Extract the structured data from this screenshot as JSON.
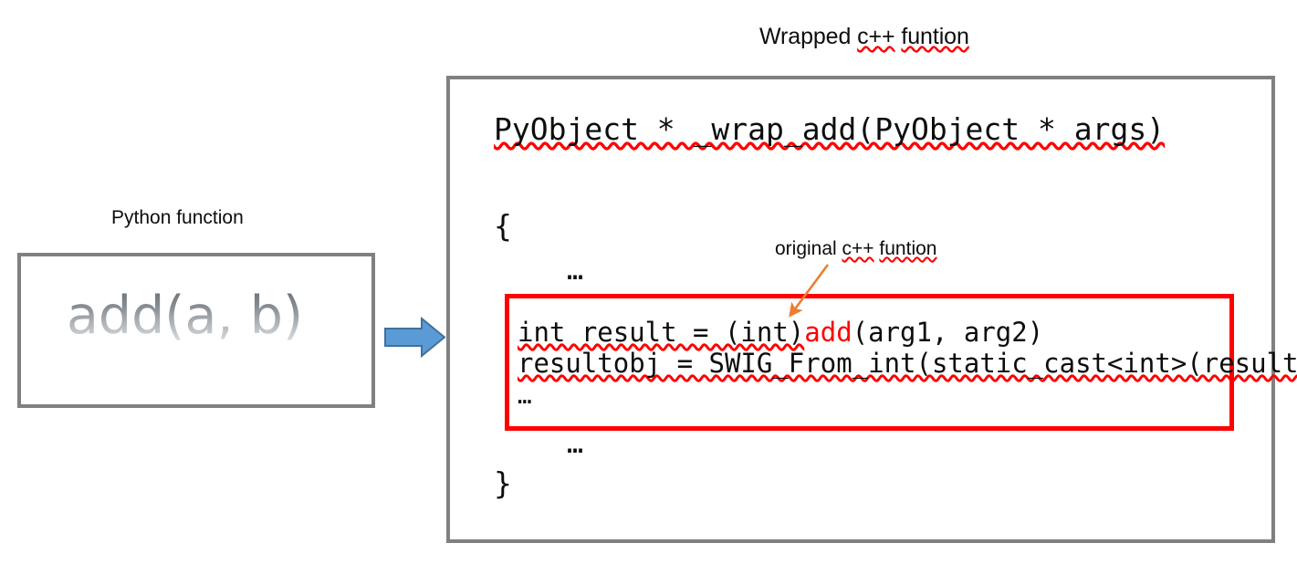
{
  "diagram": {
    "title_wrapped": {
      "prefix": "Wrapped ",
      "misspelled_1": "c++",
      "gap": " ",
      "misspelled_2": "funtion"
    },
    "python_side": {
      "label": "Python function",
      "code": "add(a, b)"
    },
    "arrow_flow": {
      "name": "right-arrow",
      "color": "#5b9bd5"
    },
    "wrapped_side": {
      "signature": "PyObject * _wrap_add(PyObject * args)",
      "brace_open": "{",
      "ellipsis_1": "…",
      "ellipsis_2": "…",
      "brace_close": "}"
    },
    "highlight": {
      "line1_before": "int result = (int)",
      "line1_call": "add",
      "line1_after": "(arg1, arg2)",
      "line2": "resultobj = SWIG_From_int(static_cast<int>(result))",
      "ellipsis": "…",
      "border_color": "#ff0000"
    },
    "annotation": {
      "prefix": "original ",
      "misspelled_1": "c++",
      "gap": " ",
      "misspelled_2": "funtion",
      "arrow_color": "#ed7d31"
    },
    "colors": {
      "box_border": "#808080",
      "red": "#ff0000",
      "orange": "#ed7d31",
      "blue": "#5b9bd5",
      "blue_stroke": "#41719c",
      "text": "#0d0d0d"
    }
  }
}
